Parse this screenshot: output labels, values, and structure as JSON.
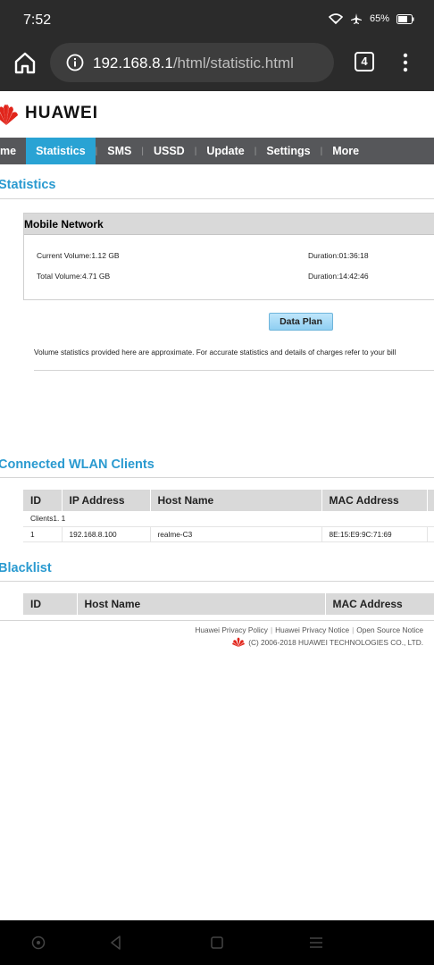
{
  "status_bar": {
    "time": "7:52",
    "battery": "65%"
  },
  "browser": {
    "url_host": "192.168.8.1",
    "url_path": "/html/statistic.html",
    "tab_count": "4"
  },
  "header": {
    "brand": "HUAWEI"
  },
  "nav": {
    "items": [
      "me",
      "Statistics",
      "SMS",
      "USSD",
      "Update",
      "Settings",
      "More"
    ],
    "active_index": 1
  },
  "statistics": {
    "title": "Statistics",
    "mobile_network": {
      "heading": "Mobile Network",
      "current_volume": "Current Volume:1.12 GB",
      "duration_current": "Duration:01:36:18",
      "total_volume": "Total Volume:4.71 GB",
      "duration_total": "Duration:14:42:46"
    },
    "data_plan_button": "Data Plan",
    "note": "Volume statistics provided here are approximate. For accurate statistics and details of charges refer to your bill"
  },
  "wlan_clients": {
    "title": "Connected WLAN Clients",
    "columns": [
      "ID",
      "IP Address",
      "Host Name",
      "MAC Address"
    ],
    "clients_count_label": "Clients1. 1",
    "rows": [
      {
        "id": "1",
        "ip": "192.168.8.100",
        "host": "realme-C3",
        "mac": "8E:15:E9:9C:71:69"
      }
    ]
  },
  "blacklist": {
    "title": "Blacklist",
    "columns": [
      "ID",
      "Host Name",
      "MAC Address"
    ]
  },
  "footer": {
    "privacy_policy": "Huawei Privacy Policy",
    "privacy_notice": "Huawei Privacy Notice",
    "open_source": "Open Source Notice",
    "copyright": "(C) 2006-2018 HUAWEI TECHNOLOGIES CO., LTD."
  },
  "colors": {
    "accent": "#2a9ad0",
    "nav_bg": "#56575a",
    "nav_active": "#29a3d4",
    "brand_red": "#e1251b"
  }
}
